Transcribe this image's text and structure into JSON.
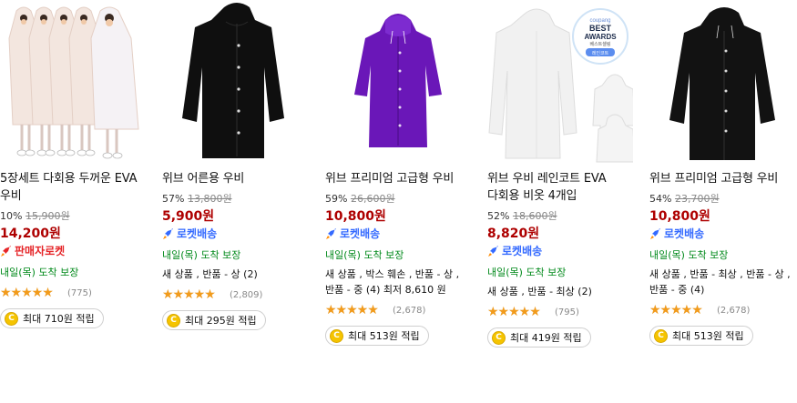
{
  "products": [
    {
      "title": "5장세트 다회용 두꺼운 EVA 우비",
      "discount_pct": "10%",
      "original_price": "15,900원",
      "price": "14,200원",
      "shipping": "판매자로켓",
      "shipping_type": "seller",
      "arrival": "내일(목) 도착 보장",
      "options": "",
      "rating": 4.5,
      "review_count": "(775)",
      "cashback": "최대 710원 적립",
      "image": "five-white-raincoats"
    },
    {
      "title": "위브 어른용 우비",
      "discount_pct": "57%",
      "original_price": "13,800원",
      "price": "5,900원",
      "shipping": "로켓배송",
      "shipping_type": "rocket",
      "arrival": "내일(목) 도착 보장",
      "options": "새 상품 , 반품 - 상 (2)",
      "rating": 4.5,
      "review_count": "(2,809)",
      "cashback": "최대 295원 적립",
      "image": "black-raincoat"
    },
    {
      "title": "위브 프리미엄 고급형 우비",
      "discount_pct": "59%",
      "original_price": "26,600원",
      "price": "10,800원",
      "shipping": "로켓배송",
      "shipping_type": "rocket",
      "arrival": "내일(목) 도착 보장",
      "options": "새 상품 , 박스 훼손 , 반품 - 상 , 반품 - 중 (4) 최저 8,610 원",
      "rating": 4.5,
      "review_count": "(2,678)",
      "cashback": "최대 513원 적립",
      "image": "purple-raincoat"
    },
    {
      "title": "위브 우비 레인코트 EVA 다회용 비옷 4개입",
      "discount_pct": "52%",
      "original_price": "18,600원",
      "price": "8,820원",
      "shipping": "로켓배송",
      "shipping_type": "rocket",
      "arrival": "내일(목) 도착 보장",
      "options": "새 상품 , 반품 - 최상 (2)",
      "rating": 4.5,
      "review_count": "(795)",
      "cashback": "최대 419원 적립",
      "image": "clear-raincoat-award",
      "award_badge": {
        "brand": "coupang",
        "line1": "BEST",
        "line2": "AWARDS",
        "line3": "베스트셀링",
        "line4": "레인코트"
      }
    },
    {
      "title": "위브 프리미엄 고급형 우비",
      "discount_pct": "54%",
      "original_price": "23,700원",
      "price": "10,800원",
      "shipping": "로켓배송",
      "shipping_type": "rocket",
      "arrival": "내일(목) 도착 보장",
      "options": "새 상품 , 반품 - 최상 , 반품 - 상 , 반품 - 중 (4)",
      "rating": 4.5,
      "review_count": "(2,678)",
      "cashback": "최대 513원 적립",
      "image": "black-raincoat-premium"
    }
  ],
  "colors": {
    "price": "#ae0000",
    "rocket": "#346aff",
    "seller_rocket": "#e52528",
    "arrival": "#00891a",
    "star": "#f29b1b",
    "coin": "#f5c400"
  }
}
